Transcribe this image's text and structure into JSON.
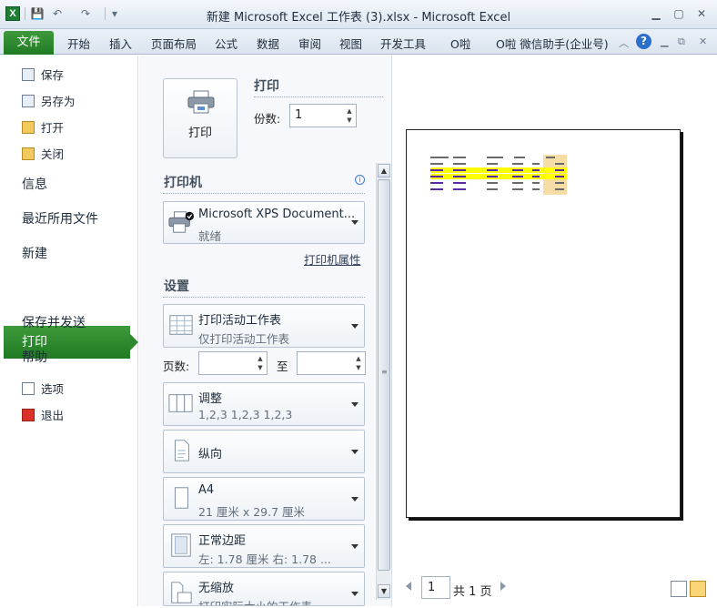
{
  "window": {
    "title": "新建 Microsoft Excel 工作表 (3).xlsx  -  Microsoft Excel",
    "app_icon_letter": "X"
  },
  "quick_access": [
    {
      "name": "save",
      "glyph": "💾"
    },
    {
      "name": "undo",
      "glyph": "↶"
    },
    {
      "name": "redo",
      "glyph": "↷"
    },
    {
      "name": "customize",
      "glyph": "▾"
    }
  ],
  "ribbon": {
    "file_tab": "文件",
    "tabs": [
      "开始",
      "插入",
      "页面布局",
      "公式",
      "数据",
      "审阅",
      "视图",
      "开发工具",
      "O啦",
      "O啦 微信助手(企业号)"
    ],
    "help_glyph": "?"
  },
  "backstage": {
    "top_commands": [
      {
        "label": "保存",
        "icon": "save-icon"
      },
      {
        "label": "另存为",
        "icon": "save-as-icon"
      },
      {
        "label": "打开",
        "icon": "open-folder-icon"
      },
      {
        "label": "关闭",
        "icon": "close-folder-icon"
      }
    ],
    "sections": [
      "信息",
      "最近所用文件",
      "新建",
      "打印",
      "保存并发送",
      "帮助"
    ],
    "active_section": "打印",
    "bottom_commands": [
      {
        "label": "选项",
        "icon": "options-icon"
      },
      {
        "label": "退出",
        "icon": "exit-icon"
      }
    ]
  },
  "print": {
    "heading": "打印",
    "button_label": "打印",
    "copies_label": "份数:",
    "copies_value": "1",
    "printer_heading": "打印机",
    "printer_name": "Microsoft XPS Document...",
    "printer_status": "就绪",
    "printer_properties": "打印机属性",
    "settings_heading": "设置",
    "settings": [
      {
        "title": "打印活动工作表",
        "subtitle": "仅打印活动工作表",
        "icon": "sheet-icon"
      },
      {
        "title": "调整",
        "subtitle": "1,2,3    1,2,3    1,2,3",
        "icon": "collate-icon"
      },
      {
        "title": "纵向",
        "subtitle": "",
        "icon": "portrait-icon"
      },
      {
        "title": "A4",
        "subtitle": "21 厘米 x 29.7 厘米",
        "icon": "paper-size-icon"
      },
      {
        "title": "正常边距",
        "subtitle": "左: 1.78 厘米    右: 1.78 ...",
        "icon": "margins-icon"
      },
      {
        "title": "无缩放",
        "subtitle": "打印实际大小的工作表",
        "icon": "scaling-icon"
      }
    ],
    "pages_label": "页数:",
    "pages_to_label": "至",
    "pages_from": "",
    "pages_to": ""
  },
  "preview": {
    "current_page": "1",
    "total_pages_text": "共 1 页"
  }
}
